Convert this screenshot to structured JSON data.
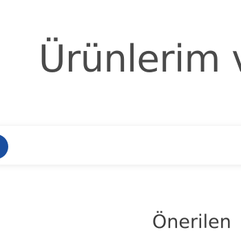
{
  "header": {
    "title": "Ürünlerim ve"
  },
  "search": {
    "button_label": ""
  },
  "section": {
    "suggested_label": "Önerilen"
  },
  "colors": {
    "accent": "#1a4fa0",
    "title_text": "#4a4a4a",
    "body_text": "#3d3d3d",
    "background": "#ffffff"
  }
}
